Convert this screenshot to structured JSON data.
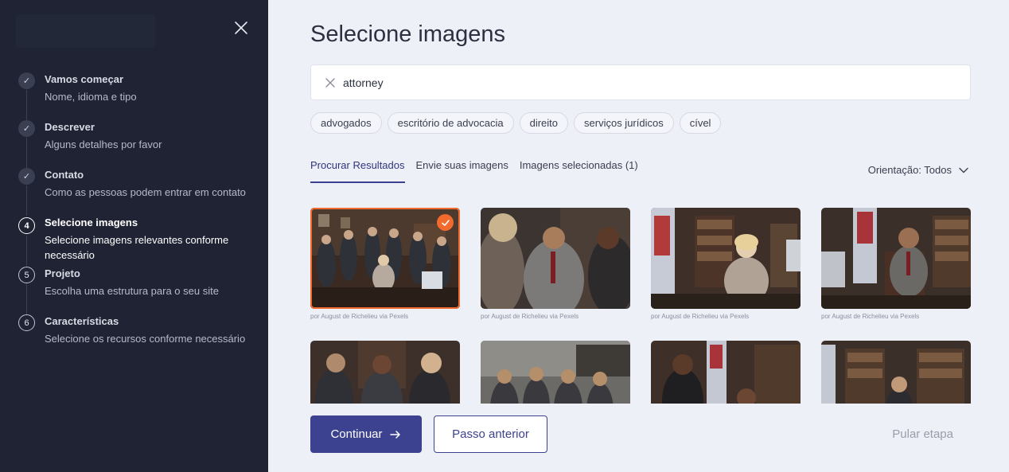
{
  "sidebar": {
    "steps": [
      {
        "index": "1",
        "state": "done",
        "title": "Vamos começar",
        "desc": "Nome, idioma e tipo"
      },
      {
        "index": "2",
        "state": "done",
        "title": "Descrever",
        "desc": "Alguns detalhes por favor"
      },
      {
        "index": "3",
        "state": "done",
        "title": "Contato",
        "desc": "Como as pessoas podem entrar em contato"
      },
      {
        "index": "4",
        "state": "active",
        "title": "Selecione imagens",
        "desc": "Selecione imagens relevantes conforme necessário"
      },
      {
        "index": "5",
        "state": "todo",
        "title": "Projeto",
        "desc": "Escolha uma estrutura para o seu site"
      },
      {
        "index": "6",
        "state": "todo",
        "title": "Características",
        "desc": "Selecione os recursos conforme necessário"
      }
    ]
  },
  "main": {
    "title": "Selecione imagens",
    "search": {
      "value": "attorney"
    },
    "chips": [
      "advogados",
      "escritório de advocacia",
      "direito",
      "serviços jurídicos",
      "cível"
    ],
    "tabs": [
      "Procurar Resultados",
      "Envie suas imagens",
      "Imagens selecionadas (1)"
    ],
    "orientation_label": "Orientação: Todos",
    "images": [
      {
        "caption": "por August de Richelieu via Pexels",
        "selected": true
      },
      {
        "caption": "por August de Richelieu via Pexels",
        "selected": false
      },
      {
        "caption": "por August de Richelieu via Pexels",
        "selected": false
      },
      {
        "caption": "por August de Richelieu via Pexels",
        "selected": false
      },
      {
        "caption": "",
        "selected": false
      },
      {
        "caption": "",
        "selected": false
      },
      {
        "caption": "",
        "selected": false
      },
      {
        "caption": "",
        "selected": false
      }
    ],
    "continue_label": "Continuar",
    "back_label": "Passo anterior",
    "skip_label": "Pular etapa"
  },
  "colors": {
    "sidebar_bg": "#1f2333",
    "accent": "#3d4290",
    "selected": "#f26a2e",
    "main_bg": "#eef0f8"
  }
}
